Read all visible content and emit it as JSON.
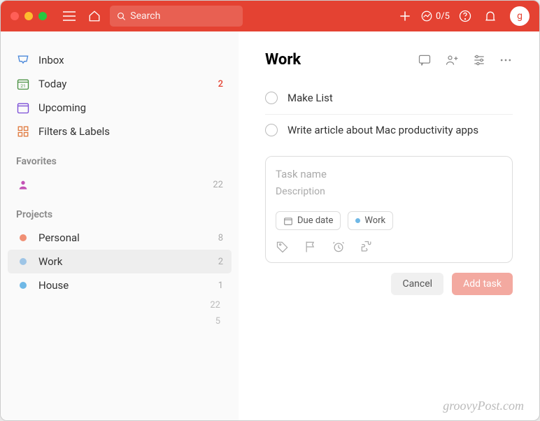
{
  "titlebar": {
    "search_placeholder": "Search",
    "productivity": "0/5",
    "avatar": "g"
  },
  "sidebar": {
    "today_date": "21",
    "nav": [
      {
        "label": "Inbox"
      },
      {
        "label": "Today",
        "count": "2"
      },
      {
        "label": "Upcoming"
      },
      {
        "label": "Filters & Labels"
      }
    ],
    "favorites_title": "Favorites",
    "favorites": [
      {
        "label": "",
        "count": "22"
      }
    ],
    "projects_title": "Projects",
    "projects": [
      {
        "label": "Personal",
        "count": "8",
        "color": "#f08f74"
      },
      {
        "label": "Work",
        "count": "2",
        "color": "#9ec5e6",
        "selected": true
      },
      {
        "label": "House",
        "count": "1",
        "color": "#6fb8e6"
      }
    ],
    "totals": [
      "22",
      "5"
    ]
  },
  "main": {
    "title": "Work",
    "tasks": [
      {
        "title": "Make List"
      },
      {
        "title": "Write article about Mac productivity apps"
      }
    ],
    "composer": {
      "name_placeholder": "Task name",
      "desc_placeholder": "Description",
      "due_label": "Due date",
      "project_label": "Work",
      "cancel": "Cancel",
      "add": "Add task"
    }
  },
  "watermark": "groovyPost.com"
}
